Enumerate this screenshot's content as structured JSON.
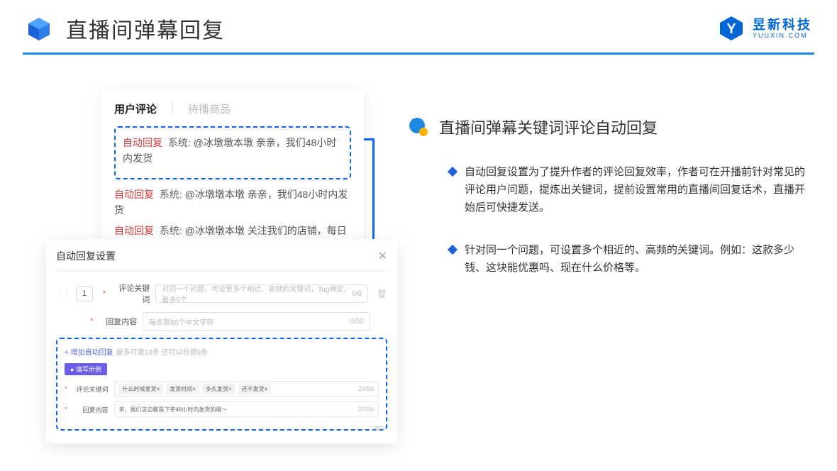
{
  "header": {
    "title": "直播间弹幕回复"
  },
  "brand": {
    "cn": "昱新科技",
    "en": "YUUXIN.COM"
  },
  "comments": {
    "tab1": "用户评论",
    "tab2": "待播商品",
    "row_badge": "自动回复",
    "row_sys": "系统:",
    "row1": "@冰墩墩本墩 亲亲，我们48小时内发货",
    "row2": "@冰墩墩本墩 亲亲，我们48小时内发货",
    "row3": "@冰墩墩本墩 关注我们的店铺，每日都有热门推荐呦～"
  },
  "settings": {
    "title": "自动回复设置",
    "num": "1",
    "lbl_keyword": "评论关键词",
    "ph_keyword": "对同一个问题，可设置多个相近、高频的关键词，Tag确定，最多5个",
    "cnt_keyword": "0/8",
    "lbl_content": "回复内容",
    "ph_content": "每条限50个中文字符",
    "cnt_content": "0/50",
    "add_link": "+ 增加自动回复",
    "add_hint": "最多可建10条 还可以创建9条",
    "chip": "● 填写示例",
    "ex_kw_label": "评论关键词",
    "ex_tags": [
      "什么时候发货×",
      "发货时间×",
      "多久发货×",
      "还不发货×"
    ],
    "ex_kw_count": "20/50",
    "ex_ct_label": "回复内容",
    "ex_ct_value": "亲，我们这边都是下单48小时内发货的哦～",
    "ex_ct_count": "37/50",
    "extra": "/50"
  },
  "right": {
    "section_title": "直播间弹幕关键词评论自动回复",
    "bullet1": "自动回复设置为了提升作者的评论回复效率，作者可在开播前针对常见的评论用户问题，提炼出关键词，提前设置常用的直播间回复话术，直播开始后可快捷发送。",
    "bullet2": "针对同一个问题，可设置多个相近的、高频的关键词。例如：这款多少钱、这块能优惠吗、现在什么价格等。"
  }
}
